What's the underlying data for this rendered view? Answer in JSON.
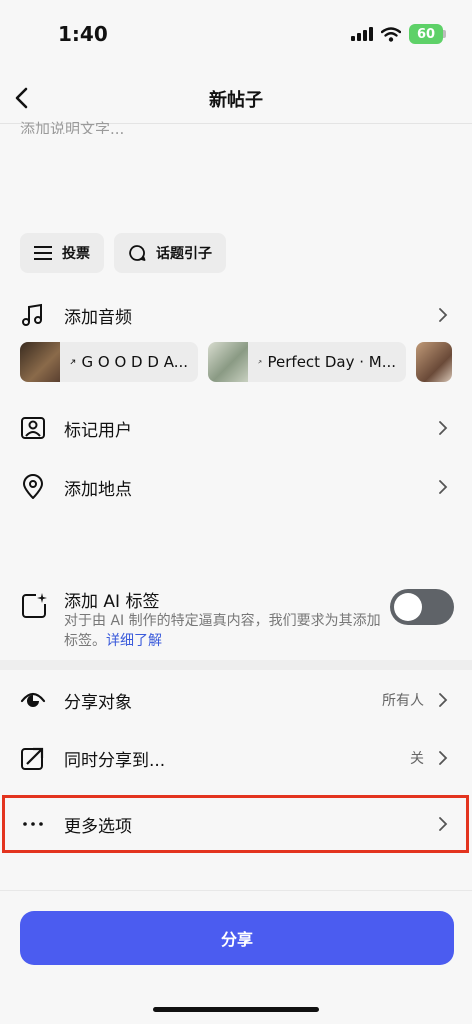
{
  "status": {
    "time": "1:40",
    "battery": "60"
  },
  "header": {
    "title": "新帖子"
  },
  "caption": {
    "placeholder": "添加说明文字..."
  },
  "chips": {
    "poll": "投票",
    "prompt": "话题引子"
  },
  "rows": {
    "music": "添加音频",
    "tag": "标记用户",
    "location": "添加地点",
    "audience": {
      "label": "分享对象",
      "value": "所有人"
    },
    "crosspost": {
      "label": "同时分享到...",
      "value": "关"
    },
    "more": "更多选项"
  },
  "music_chips": [
    {
      "title": "G O O D D A..."
    },
    {
      "title": "Perfect Day · M..."
    }
  ],
  "ai_label": {
    "title": "添加 AI 标签",
    "desc": "对于由 AI 制作的特定逼真内容，我们要求为其添加标签。",
    "link": "详细了解",
    "on": false
  },
  "share_button": "分享",
  "colors": {
    "accent": "#4b5cf0",
    "link": "#3b5bdb",
    "highlight": "#e3341f"
  }
}
